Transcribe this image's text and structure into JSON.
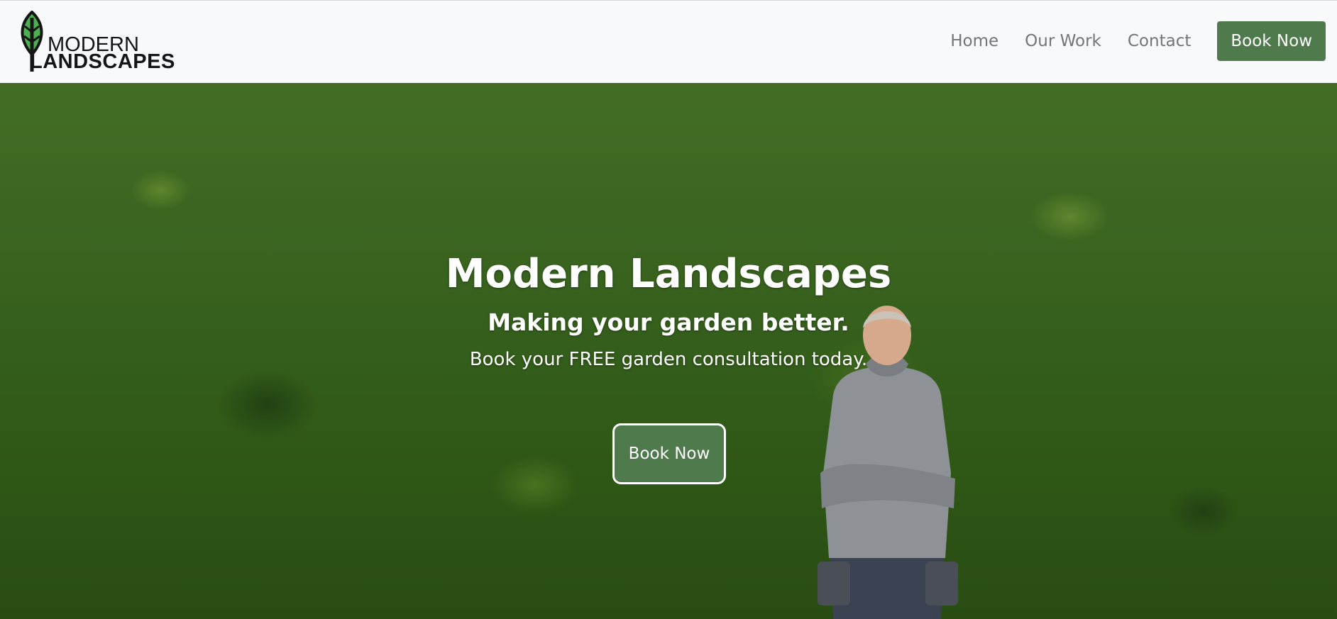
{
  "brand": {
    "line1": "MODERN",
    "line2": "LANDSCAPES",
    "logo_icon": "leaf-icon",
    "accent_color": "#4f7a4c"
  },
  "nav": {
    "links": [
      "Home",
      "Our Work",
      "Contact"
    ],
    "cta": "Book Now"
  },
  "hero": {
    "title": "Modern Landscapes",
    "subtitle": "Making your garden better.",
    "text": "Book your FREE garden consultation today.",
    "cta": "Book Now"
  }
}
